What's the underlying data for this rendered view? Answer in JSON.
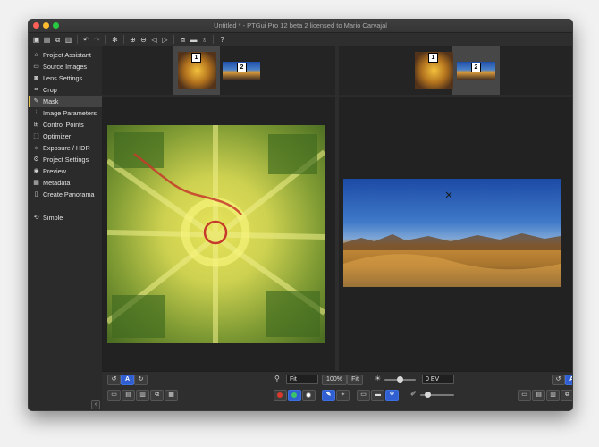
{
  "window": {
    "title": "Untitled * - PTGui Pro 12 beta 2 licensed to Mario Carvajal"
  },
  "toolbar": {
    "icons": [
      "new-project-icon",
      "open-icon",
      "duplicate-icon",
      "save-icon",
      "undo-icon",
      "redo-icon",
      "settings-icon",
      "zoom-in-icon",
      "zoom-out-icon",
      "previous-icon",
      "next-icon",
      "images-icon",
      "panorama-editor-icon",
      "light-icon",
      "help-icon"
    ]
  },
  "sidebar": {
    "items": [
      {
        "label": "Project Assistant",
        "icon": "house-icon"
      },
      {
        "label": "Source Images",
        "icon": "images-icon"
      },
      {
        "label": "Lens Settings",
        "icon": "lens-icon"
      },
      {
        "label": "Crop",
        "icon": "crop-icon"
      },
      {
        "label": "Mask",
        "icon": "brush-icon"
      },
      {
        "label": "Image Parameters",
        "icon": "sliders-icon"
      },
      {
        "label": "Control Points",
        "icon": "control-points-icon"
      },
      {
        "label": "Optimizer",
        "icon": "optimizer-icon"
      },
      {
        "label": "Exposure / HDR",
        "icon": "sun-icon"
      },
      {
        "label": "Project Settings",
        "icon": "gear-icon"
      },
      {
        "label": "Preview",
        "icon": "eye-icon"
      },
      {
        "label": "Metadata",
        "icon": "metadata-icon"
      },
      {
        "label": "Create Panorama",
        "icon": "panorama-icon"
      }
    ],
    "simple": {
      "label": "Simple",
      "icon": "circle-arrow-icon"
    },
    "active_index": 4
  },
  "left_strip": {
    "thumbs": [
      {
        "num": "1"
      },
      {
        "num": "2"
      }
    ],
    "selected": 0
  },
  "right_strip": {
    "thumbs": [
      {
        "num": "1"
      },
      {
        "num": "2"
      }
    ],
    "selected": 1
  },
  "bottom": {
    "left_a": "A",
    "right_a": "A",
    "zoom_fit": "Fit",
    "zoom_100": "100%",
    "zoom_fit_btn": "Fit",
    "exposure_value": "0 EV"
  },
  "colors": {
    "accent": "#e8c14a",
    "blue": "#2f5fd0",
    "mask_red": "#c63a2c"
  }
}
